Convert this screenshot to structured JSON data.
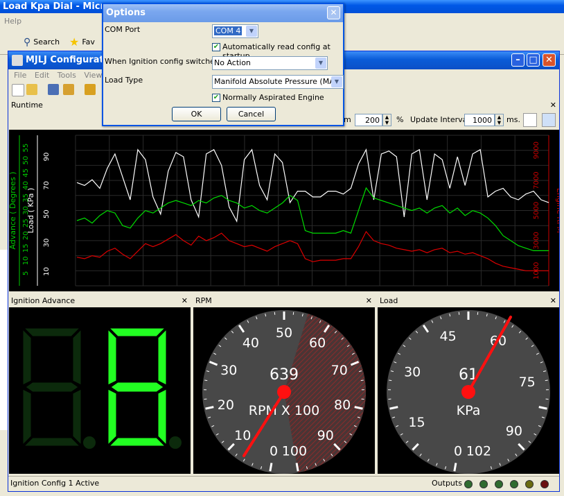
{
  "background_window": {
    "title": "Load Kpa Dial - Microso",
    "menu_help": "Help",
    "search_label": "Search",
    "favorites_label": "Fav"
  },
  "app": {
    "title": "MJLJ Configurator",
    "menu": [
      "File",
      "Edit",
      "Tools",
      "View"
    ]
  },
  "runtime": {
    "title": "Runtime",
    "zoom_unit_prefix": "m",
    "zoom_value": "200",
    "zoom_unit": "%",
    "update_label": "Update Interval",
    "update_value": "1000",
    "update_unit": "ms."
  },
  "chart_data": {
    "type": "line",
    "axes": {
      "advance": {
        "label": "Advance ( Degrees )",
        "ticks": [
          "5",
          "10",
          "15",
          "20",
          "25",
          "30",
          "35",
          "40",
          "45",
          "50",
          "55"
        ],
        "color": "#00cc00"
      },
      "load": {
        "label": "Load ( KPa )",
        "ticks": [
          "10",
          "30",
          "50",
          "70",
          "90"
        ],
        "color": "#ffffff"
      },
      "rpm": {
        "label": "Engine RPM",
        "ticks": [
          "1000",
          "3000",
          "5000",
          "7000",
          "9000"
        ],
        "color": "#cc0000"
      }
    },
    "series": [
      {
        "axis": "load",
        "color": "#ffffff",
        "values": [
          72,
          70,
          74,
          68,
          82,
          92,
          76,
          60,
          95,
          88,
          62,
          50,
          80,
          93,
          90,
          60,
          48,
          92,
          95,
          84,
          55,
          45,
          88,
          95,
          70,
          60,
          92,
          86,
          58,
          66,
          66,
          62,
          62,
          66,
          66,
          64,
          68,
          85,
          95,
          60,
          92,
          94,
          90,
          48,
          92,
          95,
          60,
          92,
          88,
          68,
          90,
          70,
          92,
          95,
          62,
          66,
          68,
          62,
          60,
          64,
          66,
          60,
          58
        ]
      },
      {
        "axis": "advance",
        "color": "#00dd00",
        "values": [
          26,
          27,
          25,
          28,
          30,
          29,
          24,
          23,
          27,
          30,
          29,
          31,
          33,
          34,
          33,
          32,
          34,
          33,
          35,
          36,
          34,
          33,
          31,
          32,
          30,
          29,
          31,
          33,
          36,
          34,
          22,
          21,
          21,
          21,
          21,
          22,
          21,
          30,
          39,
          35,
          34,
          33,
          32,
          31,
          30,
          31,
          29,
          31,
          32,
          29,
          31,
          28,
          30,
          29,
          27,
          24,
          20,
          18,
          16,
          15,
          14,
          14,
          14
        ]
      },
      {
        "axis": "rpm",
        "color": "#dd0000",
        "values": [
          1900,
          1800,
          2000,
          1900,
          2300,
          2500,
          2100,
          1800,
          2300,
          2800,
          2600,
          2800,
          3100,
          3400,
          3000,
          2700,
          3300,
          3000,
          3200,
          3500,
          3000,
          2800,
          2600,
          2700,
          2500,
          2300,
          2600,
          2800,
          3000,
          2800,
          1800,
          1600,
          1700,
          1700,
          1700,
          1800,
          1800,
          2600,
          3600,
          3000,
          2800,
          2700,
          2500,
          2400,
          2300,
          2400,
          2200,
          2400,
          2500,
          2200,
          2300,
          2100,
          2200,
          2000,
          1800,
          1500,
          1300,
          1200,
          1100,
          1000,
          1000,
          1000,
          1000
        ]
      }
    ]
  },
  "ignition": {
    "title": "Ignition Advance",
    "digit_tens_lit": false,
    "digit_ones": "8"
  },
  "rpm_gauge": {
    "title": "RPM",
    "value": "639",
    "unit": "RPM X 100",
    "ticks": [
      "0",
      "10",
      "20",
      "30",
      "40",
      "50",
      "60",
      "70",
      "80",
      "90",
      "100"
    ],
    "redline_start": 55
  },
  "load_gauge": {
    "title": "Load",
    "value": "61",
    "unit": "KPa",
    "ticks": [
      "0",
      "15",
      "30",
      "45",
      "60",
      "75",
      "90",
      "102"
    ]
  },
  "status": {
    "text": "Ignition Config 1 Active",
    "outputs_label": "Outputs",
    "leds": [
      "#2f6b2f",
      "#2f6b2f",
      "#2f6b2f",
      "#2f6b2f",
      "#6b6b10",
      "#6b1010"
    ]
  },
  "dialog": {
    "title": "Options",
    "com_label": "COM Port",
    "com_value": "COM 4",
    "auto_read_label": "Automatically read config at startup",
    "ign_switch_label": "When Ignition config switched:",
    "ign_switch_value": "No Action",
    "load_type_label": "Load Type",
    "load_type_value": "Manifold Absolute Pressure (MAP)",
    "na_label": "Normally Aspirated Engine",
    "ok_label": "OK",
    "cancel_label": "Cancel"
  }
}
